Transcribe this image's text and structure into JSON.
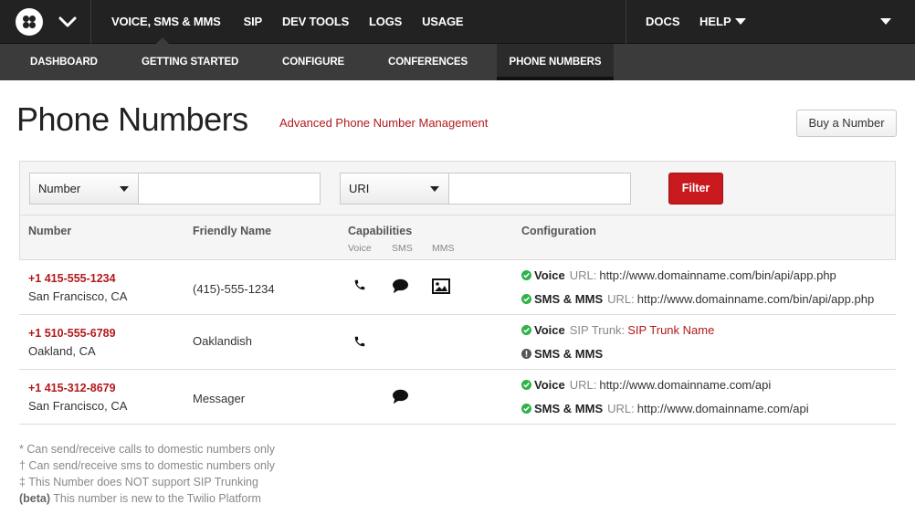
{
  "top_nav": {
    "items": [
      "VOICE, SMS & MMS",
      "SIP",
      "DEV TOOLS",
      "LOGS",
      "USAGE"
    ],
    "right": {
      "docs": "DOCS",
      "help": "HELP"
    }
  },
  "sub_nav": {
    "items": [
      "DASHBOARD",
      "GETTING STARTED",
      "CONFIGURE",
      "CONFERENCES",
      "PHONE NUMBERS"
    ],
    "active": "PHONE NUMBERS"
  },
  "page": {
    "title": "Phone Numbers",
    "advanced_link": "Advanced Phone Number Management",
    "buy_button": "Buy a Number"
  },
  "filters": {
    "select1": "Number",
    "select2": "URI",
    "input1_value": "",
    "input2_value": "",
    "filter_button": "Filter"
  },
  "table": {
    "headers": {
      "number": "Number",
      "friendly_name": "Friendly Name",
      "capabilities": "Capabilities",
      "configuration": "Configuration"
    },
    "capability_headers": [
      "Voice",
      "SMS",
      "MMS"
    ],
    "rows": [
      {
        "number": "+1 415-555-1234",
        "location": "San Francisco, CA",
        "friendly_name": "(415)-555-1234",
        "capabilities": {
          "voice": true,
          "sms": true,
          "mms": true
        },
        "config": [
          {
            "status": "ok",
            "kind": "Voice",
            "label": "URL:",
            "value": "http://www.domainname.com/bin/api/app.php",
            "value_link": false
          },
          {
            "status": "ok",
            "kind": "SMS & MMS",
            "label": "URL:",
            "value": "http://www.domainname.com/bin/api/app.php",
            "value_link": false
          }
        ]
      },
      {
        "number": "+1 510-555-6789",
        "location": "Oakland, CA",
        "friendly_name": "Oaklandish",
        "capabilities": {
          "voice": true,
          "sms": false,
          "mms": false
        },
        "config": [
          {
            "status": "ok",
            "kind": "Voice",
            "label": "SIP Trunk:",
            "value": "SIP Trunk Name",
            "value_link": true
          },
          {
            "status": "warn",
            "kind": "SMS & MMS",
            "label": "",
            "value": "",
            "value_link": false
          }
        ]
      },
      {
        "number": "+1 415-312-8679",
        "location": "San Francisco, CA",
        "friendly_name": "Messager",
        "capabilities": {
          "voice": false,
          "sms": true,
          "mms": false
        },
        "config": [
          {
            "status": "ok",
            "kind": "Voice",
            "label": "URL:",
            "value": "http://www.domainname.com/api",
            "value_link": false
          },
          {
            "status": "ok",
            "kind": "SMS & MMS",
            "label": "URL:",
            "value": "http://www.domainname.com/api",
            "value_link": false
          }
        ]
      }
    ]
  },
  "footnotes": [
    {
      "prefix": "",
      "text": "* Can send/receive calls to domestic numbers only"
    },
    {
      "prefix": "",
      "text": "† Can send/receive sms to domestic numbers only"
    },
    {
      "prefix": "",
      "text": "‡ This Number does NOT support SIP Trunking"
    },
    {
      "prefix": "(beta)",
      "text": " This number is new to the Twilio Platform"
    }
  ],
  "colors": {
    "topbar": "#222222",
    "subnav": "#3b3b3b",
    "accent_red": "#b3191d",
    "filter_button": "#c8191e",
    "status_ok": "#2db34a"
  }
}
